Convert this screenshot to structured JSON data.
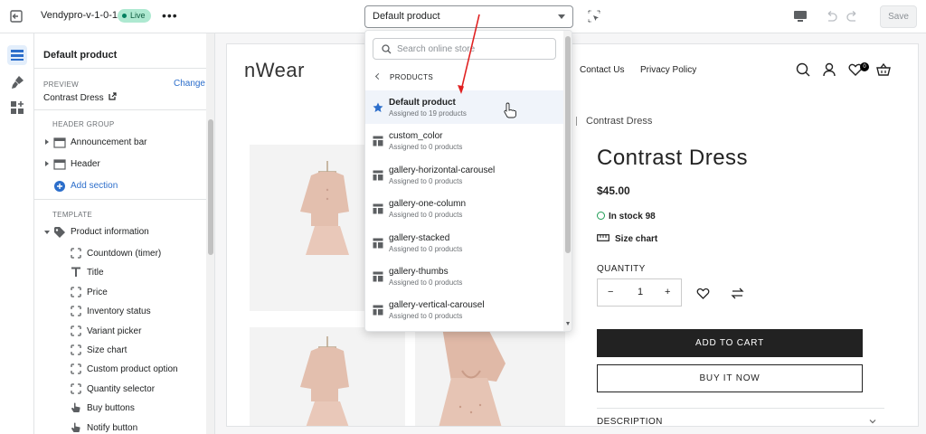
{
  "topbar": {
    "theme_name": "Vendypro-v-1-0-1",
    "live_badge": "Live",
    "more_label": "•••",
    "template_select": "Default product",
    "save_label": "Save"
  },
  "sidebar": {
    "title": "Default product",
    "preview_label": "PREVIEW",
    "preview_change": "Change",
    "preview_value": "Contrast Dress",
    "header_group_label": "HEADER GROUP",
    "header_group_items": [
      "Announcement bar",
      "Header"
    ],
    "add_section": "Add section",
    "template_label": "TEMPLATE",
    "section_name": "Product information",
    "blocks": [
      {
        "label": "Countdown (timer)",
        "icon": "dashed-square-icon"
      },
      {
        "label": "Title",
        "icon": "text-t-icon"
      },
      {
        "label": "Price",
        "icon": "dashed-square-icon"
      },
      {
        "label": "Inventory status",
        "icon": "dashed-square-icon"
      },
      {
        "label": "Variant picker",
        "icon": "dashed-square-icon"
      },
      {
        "label": "Size chart",
        "icon": "dashed-square-icon"
      },
      {
        "label": "Custom product option",
        "icon": "dashed-square-icon"
      },
      {
        "label": "Quantity selector",
        "icon": "dashed-square-icon"
      },
      {
        "label": "Buy buttons",
        "icon": "hand-pointer-icon"
      },
      {
        "label": "Notify button",
        "icon": "hand-pointer-icon"
      }
    ]
  },
  "dropdown": {
    "search_placeholder": "Search online store",
    "back_label": "PRODUCTS",
    "items": [
      {
        "name": "Default product",
        "sub": "Assigned to 19 products",
        "selected": true
      },
      {
        "name": "custom_color",
        "sub": "Assigned to 0 products"
      },
      {
        "name": "gallery-horizontal-carousel",
        "sub": "Assigned to 0 products"
      },
      {
        "name": "gallery-one-column",
        "sub": "Assigned to 0 products"
      },
      {
        "name": "gallery-stacked",
        "sub": "Assigned to 0 products"
      },
      {
        "name": "gallery-thumbs",
        "sub": "Assigned to 0 products"
      },
      {
        "name": "gallery-vertical-carousel",
        "sub": "Assigned to 0 products"
      }
    ]
  },
  "store": {
    "logo": "nWear",
    "nav": [
      "Contact Us",
      "Privacy Policy"
    ],
    "wishlist_count": "0",
    "breadcrumb": "Contrast Dress",
    "product_title": "Contrast Dress",
    "price": "$45.00",
    "stock": "In stock 98",
    "size_chart": "Size chart",
    "quantity_label": "QUANTITY",
    "quantity_value": "1",
    "qty_minus": "−",
    "qty_plus": "+",
    "add_to_cart": "ADD TO CART",
    "buy_now": "BUY IT NOW",
    "description": "DESCRIPTION"
  },
  "colors": {
    "accent": "#2c6ecb",
    "live_bg": "#aee9d1",
    "annotation_arrow": "#e02020",
    "button_dark": "#222222"
  }
}
